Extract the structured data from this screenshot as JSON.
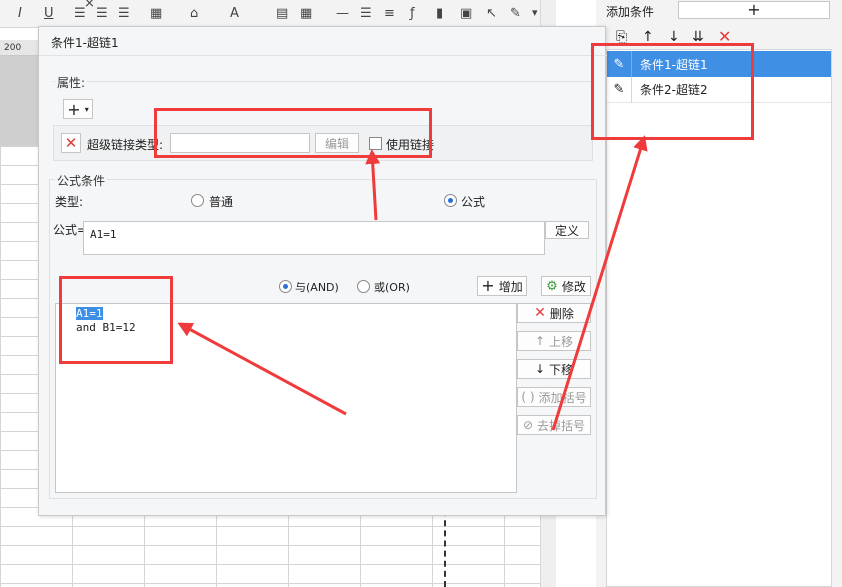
{
  "window": {
    "title": "条件1-超链1"
  },
  "background": {
    "ruler_text": "200",
    "toolbar_glyphs": [
      "I",
      "U",
      "A"
    ],
    "close_glyph": "×"
  },
  "properties": {
    "group_label": "属性:",
    "add_symbol": "+",
    "hyperlink_type_label": "超级链接类型:",
    "hyperlink_type_value": "",
    "edit_button": "编辑",
    "use_link_label": "使用链接",
    "use_link_checked": false
  },
  "formula_condition": {
    "group_label": "公式条件",
    "type_label": "类型:",
    "type_options": [
      {
        "label": "普通",
        "selected": false
      },
      {
        "label": "公式",
        "selected": true
      }
    ],
    "formula_label": "公式=",
    "formula_value": "A1=1",
    "define_button": "定义",
    "logic_options": [
      {
        "label": "与(AND)",
        "selected": true
      },
      {
        "label": "或(OR)",
        "selected": false
      }
    ],
    "add_button": "增加",
    "modify_button": "修改",
    "conditions": [
      {
        "text": "A1=1",
        "selected": true
      },
      {
        "text": "and B1=12",
        "selected": false
      }
    ],
    "side_buttons": [
      {
        "label": "删除",
        "icon": "x-icon",
        "enabled": true
      },
      {
        "label": "上移",
        "icon": "arrow-up-icon",
        "enabled": false
      },
      {
        "label": "下移",
        "icon": "arrow-down-icon",
        "enabled": true
      },
      {
        "label": "添加括号",
        "icon": "parentheses-icon",
        "enabled": false
      },
      {
        "label": "去掉括号",
        "icon": "remove-parentheses-icon",
        "enabled": false
      }
    ]
  },
  "right_panel": {
    "add_condition_label": "添加条件",
    "add_condition_symbol": "+",
    "items": [
      {
        "label": "条件1-超链1",
        "selected": true
      },
      {
        "label": "条件2-超链2",
        "selected": false
      }
    ]
  },
  "colors": {
    "selection": "#3f8fe5",
    "annotation": "#ef3b3b",
    "delete": "#e23b3b"
  }
}
